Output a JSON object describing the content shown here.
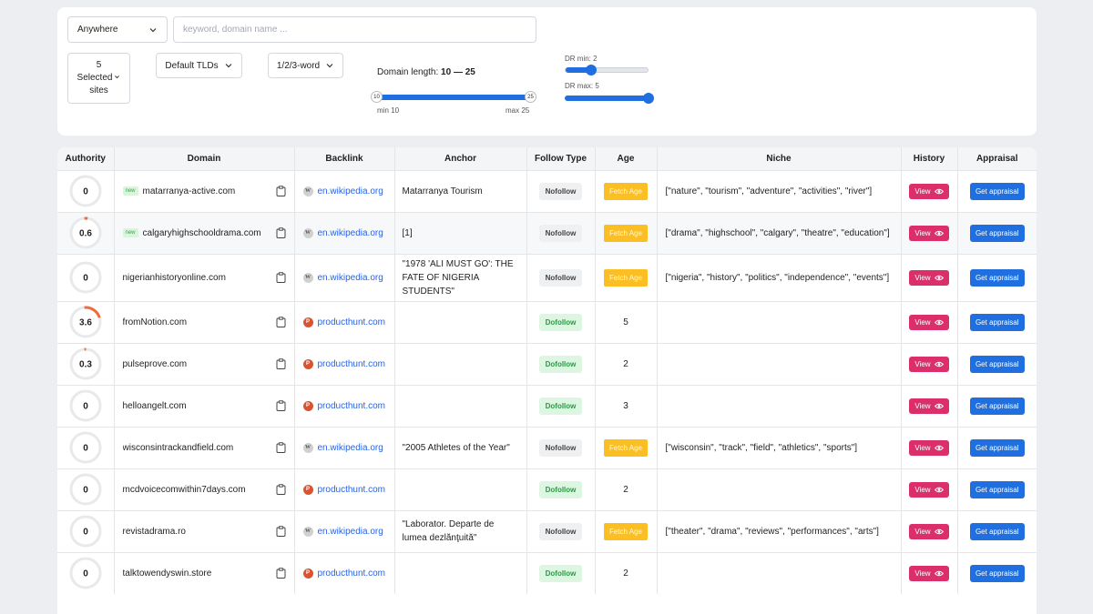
{
  "filters": {
    "location_select": "Anywhere",
    "keyword_placeholder": "keyword, domain name ...",
    "sites_select_count": "5",
    "sites_select_label": "Selected",
    "sites_select_suffix": "sites",
    "tlds_select": "Default TLDs",
    "words_select": "1/2/3-word",
    "domain_length_label": "Domain length:",
    "domain_length_value": "10 — 25",
    "length_min_handle": "10",
    "length_max_handle": "25",
    "length_min_caption": "min 10",
    "length_max_caption": "max 25",
    "length_min": 10,
    "length_max": 25,
    "dr_min_label": "DR min: 2",
    "dr_max_label": "DR max: 5",
    "dr_min": 2,
    "dr_max": 5,
    "accent_color": "#1f6fe0"
  },
  "table": {
    "columns": [
      "Authority",
      "Domain",
      "Backlink",
      "Anchor",
      "Follow Type",
      "Age",
      "Niche",
      "History",
      "Appraisal"
    ],
    "new_badge": "new",
    "view_label": "View",
    "appraisal_label": "Get appraisal",
    "fetch_age_label": "Fetch Age",
    "rows": [
      {
        "authority": "0",
        "new": true,
        "domain": "matarranya-active.com",
        "backlink": "en.wikipedia.org",
        "source": "wiki",
        "anchor": "Matarranya Tourism",
        "follow": "Nofollow",
        "age": "",
        "fetch": true,
        "niche": "[\"nature\", \"tourism\", \"adventure\", \"activities\", \"river\"]"
      },
      {
        "authority": "0.6",
        "new": true,
        "domain": "calgaryhighschooldrama.com",
        "backlink": "en.wikipedia.org",
        "source": "wiki",
        "anchor": "[1]",
        "follow": "Nofollow",
        "age": "",
        "fetch": true,
        "niche": "[\"drama\", \"highschool\", \"calgary\", \"theatre\", \"education\"]"
      },
      {
        "authority": "0",
        "new": false,
        "domain": "nigerianhistoryonline.com",
        "backlink": "en.wikipedia.org",
        "source": "wiki",
        "anchor": "\"1978 'ALI MUST GO': THE FATE OF NIGERIA STUDENTS\"",
        "follow": "Nofollow",
        "age": "",
        "fetch": true,
        "niche": "[\"nigeria\", \"history\", \"politics\", \"independence\", \"events\"]"
      },
      {
        "authority": "3.6",
        "new": false,
        "domain": "fromNotion.com",
        "backlink": "producthunt.com",
        "source": "ph",
        "anchor": "",
        "follow": "Dofollow",
        "age": "5",
        "fetch": false,
        "niche": ""
      },
      {
        "authority": "0.3",
        "new": false,
        "domain": "pulseprove.com",
        "backlink": "producthunt.com",
        "source": "ph",
        "anchor": "",
        "follow": "Dofollow",
        "age": "2",
        "fetch": false,
        "niche": ""
      },
      {
        "authority": "0",
        "new": false,
        "domain": "helloangelt.com",
        "backlink": "producthunt.com",
        "source": "ph",
        "anchor": "",
        "follow": "Dofollow",
        "age": "3",
        "fetch": false,
        "niche": ""
      },
      {
        "authority": "0",
        "new": false,
        "domain": "wisconsintrackandfield.com",
        "backlink": "en.wikipedia.org",
        "source": "wiki",
        "anchor": "\"2005 Athletes of the Year\"",
        "follow": "Nofollow",
        "age": "",
        "fetch": true,
        "niche": "[\"wisconsin\", \"track\", \"field\", \"athletics\", \"sports\"]"
      },
      {
        "authority": "0",
        "new": false,
        "domain": "mcdvoicecomwithin7days.com",
        "backlink": "producthunt.com",
        "source": "ph",
        "anchor": "",
        "follow": "Dofollow",
        "age": "2",
        "fetch": false,
        "niche": ""
      },
      {
        "authority": "0",
        "new": false,
        "domain": "revistadrama.ro",
        "backlink": "en.wikipedia.org",
        "source": "wiki",
        "anchor": "\"Laborator. Departe de lumea dezlănţuită\"",
        "follow": "Nofollow",
        "age": "",
        "fetch": true,
        "niche": "[\"theater\", \"drama\", \"reviews\", \"performances\", \"arts\"]"
      },
      {
        "authority": "0",
        "new": false,
        "domain": "talktowendyswin.store",
        "backlink": "producthunt.com",
        "source": "ph",
        "anchor": "",
        "follow": "Dofollow",
        "age": "2",
        "fetch": false,
        "niche": ""
      }
    ]
  }
}
